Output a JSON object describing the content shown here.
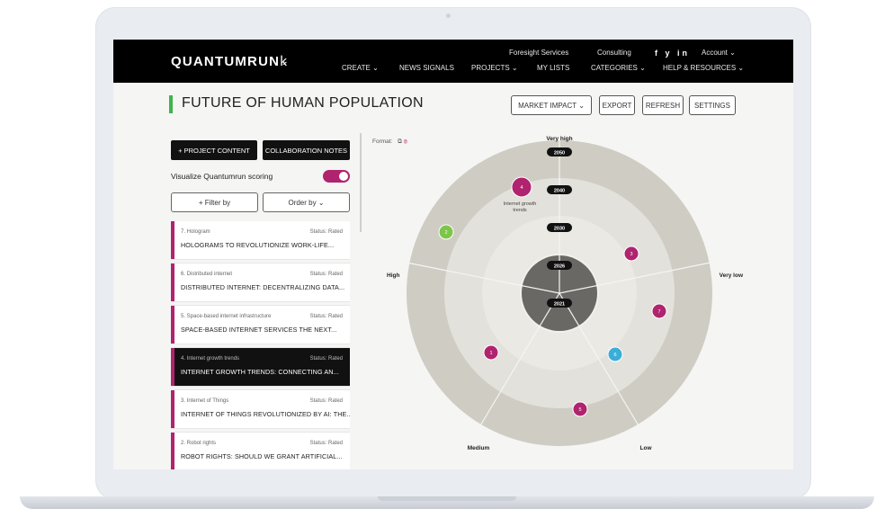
{
  "brand": {
    "logo": "QUANTUMRUN"
  },
  "nav": {
    "top": [
      "Foresight Services",
      "Consulting",
      "Account ⌄"
    ],
    "social": "f  y  in",
    "bottom": [
      "CREATE ⌄",
      "NEWS SIGNALS",
      "PROJECTS ⌄",
      "MY LISTS",
      "CATEGORIES ⌄",
      "HELP & RESOURCES ⌄"
    ]
  },
  "page": {
    "title": "FUTURE OF HUMAN POPULATION",
    "buttons": [
      "MARKET IMPACT ⌄",
      "EXPORT",
      "REFRESH",
      "SETTINGS"
    ]
  },
  "sidebar": {
    "project_content": "+ PROJECT CONTENT",
    "collab_notes": "COLLABORATION NOTES",
    "visualize_label": "Visualize Quantumrun scoring",
    "filter_label": "+ Filter by",
    "order_label": "Order by ⌄",
    "items": [
      {
        "sub": "7. Hologram",
        "status": "Status: Rated",
        "title": "HOLOGRAMS TO REVOLUTIONIZE WORK-LIFE..."
      },
      {
        "sub": "6. Distributed internet",
        "status": "Status: Rated",
        "title": "DISTRIBUTED INTERNET: DECENTRALIZING DATA..."
      },
      {
        "sub": "5. Space-based internet infrastructure",
        "status": "Status: Rated",
        "title": "SPACE-BASED INTERNET SERVICES THE NEXT..."
      },
      {
        "sub": "4. Internet growth trends",
        "status": "Status: Rated",
        "title": "INTERNET GROWTH TRENDS: CONNECTING AN..."
      },
      {
        "sub": "3. Internet of Things",
        "status": "Status: Rated",
        "title": "INTERNET OF THINGS REVOLUTIONIZED BY AI: THE..."
      },
      {
        "sub": "2. Robot rights",
        "status": "Status: Rated",
        "title": "ROBOT RIGHTS: SHOULD WE GRANT ARTIFICIAL..."
      }
    ]
  },
  "radar": {
    "format_label": "Format:",
    "directions": [
      "Very high",
      "High",
      "Very low",
      "Medium",
      "Low"
    ],
    "years": [
      "2050",
      "2040",
      "2030",
      "2026",
      "2021"
    ],
    "hover_label": [
      "Internet growth",
      "trends"
    ],
    "dots": [
      {
        "label": "4",
        "color": "#b0236f"
      },
      {
        "label": "3",
        "color": "#b0236f"
      },
      {
        "label": "7",
        "color": "#b0236f"
      },
      {
        "label": "1",
        "color": "#b0236f"
      },
      {
        "label": "5",
        "color": "#b0236f"
      },
      {
        "label": "6",
        "color": "#3aaed8"
      },
      {
        "label": "2",
        "color": "#7ec54a"
      }
    ]
  },
  "colors": {
    "accent": "#b0236f",
    "green": "#3fb34f",
    "cyan": "#3aaed8"
  }
}
